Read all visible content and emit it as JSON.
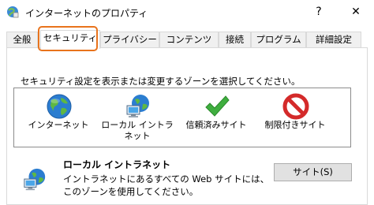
{
  "window": {
    "title": "インターネットのプロパティ",
    "help_label": "?",
    "close_label": "✕"
  },
  "tabs": [
    {
      "label": "全般"
    },
    {
      "label": "セキュリティ"
    },
    {
      "label": "プライバシー"
    },
    {
      "label": "コンテンツ"
    },
    {
      "label": "接続"
    },
    {
      "label": "プログラム"
    },
    {
      "label": "詳細設定"
    }
  ],
  "active_tab": "セキュリティ",
  "security": {
    "instruction": "セキュリティ設定を表示または変更するゾーンを選択してください。",
    "zones": [
      {
        "label": "インターネット",
        "icon": "globe-icon"
      },
      {
        "label": "ローカル イントラネット",
        "icon": "intranet-icon"
      },
      {
        "label": "信頼済みサイト",
        "icon": "checkmark-icon"
      },
      {
        "label": "制限付きサイト",
        "icon": "restricted-icon"
      }
    ],
    "selected_zone": {
      "title": "ローカル イントラネット",
      "description": "イントラネットにあるすべての Web サイトには、このゾーンを使用してください。",
      "icon": "intranet-icon"
    },
    "sites_button": "サイト(S)"
  }
}
